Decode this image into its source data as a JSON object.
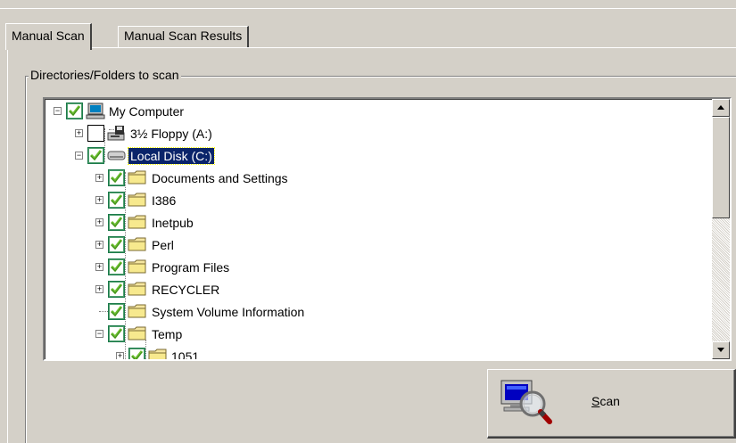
{
  "tabs": [
    {
      "label": "Manual Scan",
      "active": true
    },
    {
      "label": "Manual Scan Results",
      "active": false
    }
  ],
  "group": {
    "label": "Directories/Folders to scan"
  },
  "tree": {
    "items": [
      {
        "label": "My Computer",
        "icon": "computer-icon",
        "checked": true,
        "expander": "minus",
        "selected": false
      },
      {
        "label": "3½ Floppy (A:)",
        "icon": "floppy-drive-icon",
        "checked": false,
        "expander": "plus",
        "selected": false
      },
      {
        "label": "Local Disk (C:)",
        "icon": "hard-disk-icon",
        "checked": true,
        "expander": "minus",
        "selected": true
      },
      {
        "label": "Documents and Settings",
        "icon": "folder-icon",
        "checked": true,
        "expander": "plus",
        "selected": false
      },
      {
        "label": "I386",
        "icon": "folder-icon",
        "checked": true,
        "expander": "plus",
        "selected": false
      },
      {
        "label": "Inetpub",
        "icon": "folder-icon",
        "checked": true,
        "expander": "plus",
        "selected": false
      },
      {
        "label": "Perl",
        "icon": "folder-icon",
        "checked": true,
        "expander": "plus",
        "selected": false
      },
      {
        "label": "Program Files",
        "icon": "folder-icon",
        "checked": true,
        "expander": "plus",
        "selected": false
      },
      {
        "label": "RECYCLER",
        "icon": "folder-icon",
        "checked": true,
        "expander": "plus",
        "selected": false
      },
      {
        "label": "System Volume Information",
        "icon": "folder-icon",
        "checked": true,
        "expander": "none",
        "selected": false
      },
      {
        "label": "Temp",
        "icon": "folder-icon",
        "checked": true,
        "expander": "minus",
        "selected": false
      },
      {
        "label": "1051",
        "icon": "folder-icon",
        "checked": true,
        "expander": "plus",
        "selected": false
      }
    ]
  },
  "scan_button": {
    "label": "Scan",
    "icon": "scan-monitor-magnifier-icon"
  },
  "colors": {
    "face": "#d4d0c8",
    "selection": "#0a246a",
    "check": "#1c7a4b"
  }
}
